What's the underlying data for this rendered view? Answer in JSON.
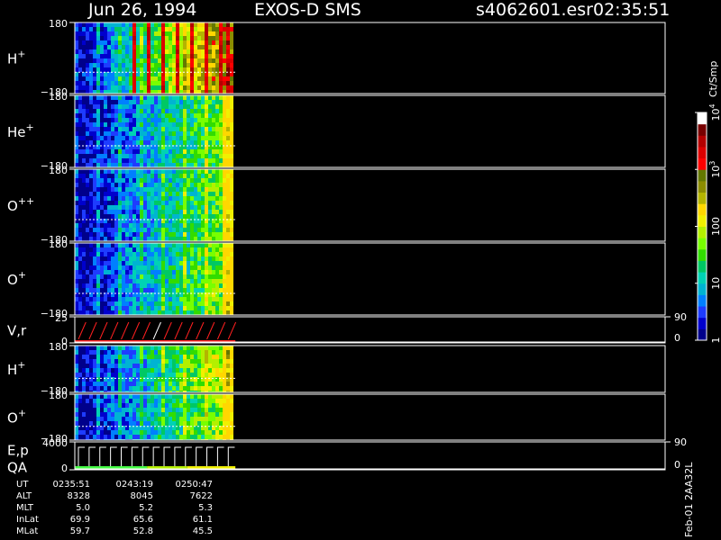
{
  "header": {
    "date": "Jun 26, 1994",
    "instrument": "EXOS-D SMS",
    "file": "s4062601.esr",
    "time": "02:35:51"
  },
  "chart_data": {
    "type": "heatmap",
    "title": "Jun 26, 1994   EXOS-D SMS",
    "panels": [
      {
        "label": "H",
        "sup": "+",
        "ymax": "180",
        "ymin": "−180",
        "kind": "spectrogram",
        "level": 0.8
      },
      {
        "label": "He",
        "sup": "+",
        "ymax": "180",
        "ymin": "−180",
        "kind": "spectrogram",
        "level": 0.45
      },
      {
        "label": "O",
        "sup": "++",
        "ymax": "180",
        "ymin": "−180",
        "kind": "spectrogram",
        "level": 0.45
      },
      {
        "label": "O",
        "sup": "+",
        "ymax": "180",
        "ymin": "−180",
        "kind": "spectrogram",
        "level": 0.48
      },
      {
        "label": "V,r",
        "sup": "",
        "ymax": "25",
        "ymin": "0",
        "right_top": "90",
        "right_bottom": "0",
        "kind": "line"
      },
      {
        "label": "H",
        "sup": "+",
        "ymax": "180",
        "ymin": "−180",
        "kind": "spectrogram",
        "level": 0.55
      },
      {
        "label": "O",
        "sup": "+",
        "ymax": "180",
        "ymin": "−180",
        "kind": "spectrogram",
        "level": 0.5
      },
      {
        "label": "E,p",
        "label2": "QA",
        "sup": "",
        "ymax": "4000",
        "ymin": "0",
        "right_top": "90",
        "right_bottom": "0",
        "kind": "line"
      }
    ],
    "colorbar": {
      "unit": "Ct/Smp",
      "ticks": [
        {
          "base": "1",
          "exp": "",
          "frac": 0.0
        },
        {
          "base": "10",
          "exp": "",
          "frac": 0.25
        },
        {
          "base": "100",
          "exp": "",
          "frac": 0.5
        },
        {
          "base": "10",
          "exp": "3",
          "frac": 0.75
        },
        {
          "base": "10",
          "exp": "4",
          "frac": 1.0
        }
      ],
      "colors": [
        "#00008b",
        "#0000cd",
        "#1e3cff",
        "#0080ff",
        "#00b4d2",
        "#00d2b4",
        "#00c864",
        "#32dc00",
        "#78ff00",
        "#b4f000",
        "#f0f000",
        "#ffd700",
        "#b4b400",
        "#8c8c00",
        "#647800",
        "#ff0000",
        "#dc0000",
        "#b40000",
        "#780000",
        "#ffffff"
      ]
    },
    "data_fraction": 0.272,
    "ephemeris": {
      "rows": [
        {
          "name": "UT",
          "values": [
            "0235:51",
            "0243:19",
            "0250:47"
          ]
        },
        {
          "name": "ALT",
          "values": [
            "8328",
            "8045",
            "7622"
          ]
        },
        {
          "name": "MLT",
          "values": [
            "5.0",
            "5.2",
            "5.3"
          ]
        },
        {
          "name": "InLat",
          "values": [
            "69.9",
            "65.6",
            "61.1"
          ]
        },
        {
          "name": "MLat",
          "values": [
            "59.7",
            "52.8",
            "45.5"
          ]
        }
      ]
    },
    "version": "Feb-01 2AA32L"
  }
}
